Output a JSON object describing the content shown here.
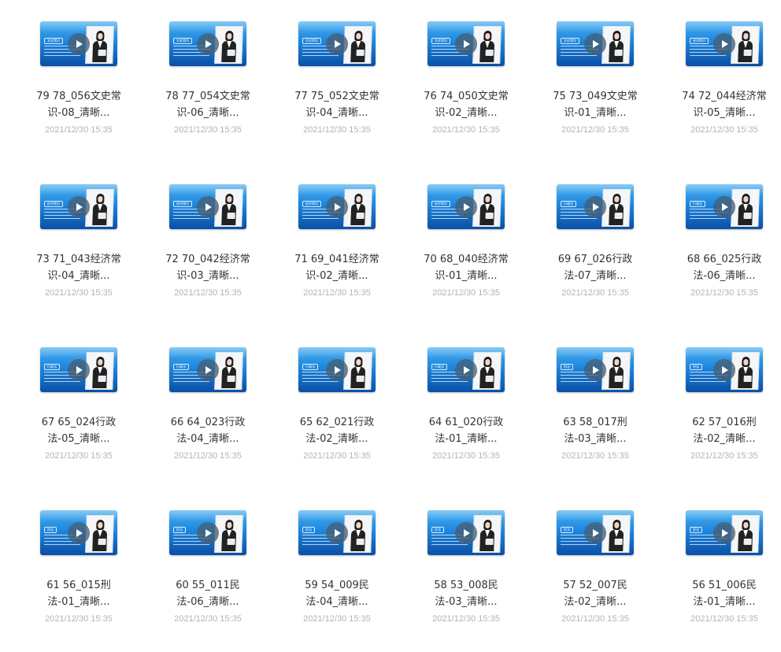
{
  "files": [
    {
      "name_line1": "79 78_056文史常",
      "name_line2": "识-08_清晰...",
      "date": "2021/12/30 15:35",
      "thumb_topic": "文史常识"
    },
    {
      "name_line1": "78 77_054文史常",
      "name_line2": "识-06_清晰...",
      "date": "2021/12/30 15:35",
      "thumb_topic": "文史常识"
    },
    {
      "name_line1": "77 75_052文史常",
      "name_line2": "识-04_清晰...",
      "date": "2021/12/30 15:35",
      "thumb_topic": "文史常识"
    },
    {
      "name_line1": "76 74_050文史常",
      "name_line2": "识-02_清晰...",
      "date": "2021/12/30 15:35",
      "thumb_topic": "文史常识"
    },
    {
      "name_line1": "75 73_049文史常",
      "name_line2": "识-01_清晰...",
      "date": "2021/12/30 15:35",
      "thumb_topic": "文史常识"
    },
    {
      "name_line1": "74 72_044经济常",
      "name_line2": "识-05_清晰...",
      "date": "2021/12/30 15:35",
      "thumb_topic": "经济常识"
    },
    {
      "name_line1": "73 71_043经济常",
      "name_line2": "识-04_清晰...",
      "date": "2021/12/30 15:35",
      "thumb_topic": "经济常识"
    },
    {
      "name_line1": "72 70_042经济常",
      "name_line2": "识-03_清晰...",
      "date": "2021/12/30 15:35",
      "thumb_topic": "经济常识"
    },
    {
      "name_line1": "71 69_041经济常",
      "name_line2": "识-02_清晰...",
      "date": "2021/12/30 15:35",
      "thumb_topic": "经济常识"
    },
    {
      "name_line1": "70 68_040经济常",
      "name_line2": "识-01_清晰...",
      "date": "2021/12/30 15:35",
      "thumb_topic": "经济常识"
    },
    {
      "name_line1": "69 67_026行政",
      "name_line2": "法-07_清晰...",
      "date": "2021/12/30 15:35",
      "thumb_topic": "行政法"
    },
    {
      "name_line1": "68 66_025行政",
      "name_line2": "法-06_清晰...",
      "date": "2021/12/30 15:35",
      "thumb_topic": "行政法"
    },
    {
      "name_line1": "67 65_024行政",
      "name_line2": "法-05_清晰...",
      "date": "2021/12/30 15:35",
      "thumb_topic": "行政法"
    },
    {
      "name_line1": "66 64_023行政",
      "name_line2": "法-04_清晰...",
      "date": "2021/12/30 15:35",
      "thumb_topic": "行政法"
    },
    {
      "name_line1": "65 62_021行政",
      "name_line2": "法-02_清晰...",
      "date": "2021/12/30 15:35",
      "thumb_topic": "行政法"
    },
    {
      "name_line1": "64 61_020行政",
      "name_line2": "法-01_清晰...",
      "date": "2021/12/30 15:35",
      "thumb_topic": "行政法"
    },
    {
      "name_line1": "63 58_017刑",
      "name_line2": "法-03_清晰...",
      "date": "2021/12/30 15:35",
      "thumb_topic": "刑法"
    },
    {
      "name_line1": "62 57_016刑",
      "name_line2": "法-02_清晰...",
      "date": "2021/12/30 15:35",
      "thumb_topic": "刑法"
    },
    {
      "name_line1": "61 56_015刑",
      "name_line2": "法-01_清晰...",
      "date": "2021/12/30 15:35",
      "thumb_topic": "刑法"
    },
    {
      "name_line1": "60 55_011民",
      "name_line2": "法-06_清晰...",
      "date": "2021/12/30 15:35",
      "thumb_topic": "民法"
    },
    {
      "name_line1": "59 54_009民",
      "name_line2": "法-04_清晰...",
      "date": "2021/12/30 15:35",
      "thumb_topic": "民法"
    },
    {
      "name_line1": "58 53_008民",
      "name_line2": "法-03_清晰...",
      "date": "2021/12/30 15:35",
      "thumb_topic": "民法"
    },
    {
      "name_line1": "57 52_007民",
      "name_line2": "法-02_清晰...",
      "date": "2021/12/30 15:35",
      "thumb_topic": "民法"
    },
    {
      "name_line1": "56 51_006民",
      "name_line2": "法-01_清晰...",
      "date": "2021/12/30 15:35",
      "thumb_topic": "民法"
    }
  ],
  "icons": {
    "play": "play-icon"
  },
  "colors": {
    "thumb_top": "#48aef0",
    "thumb_bottom": "#0a4fa6",
    "name_text": "#333333",
    "date_text": "#b3b3b3"
  }
}
